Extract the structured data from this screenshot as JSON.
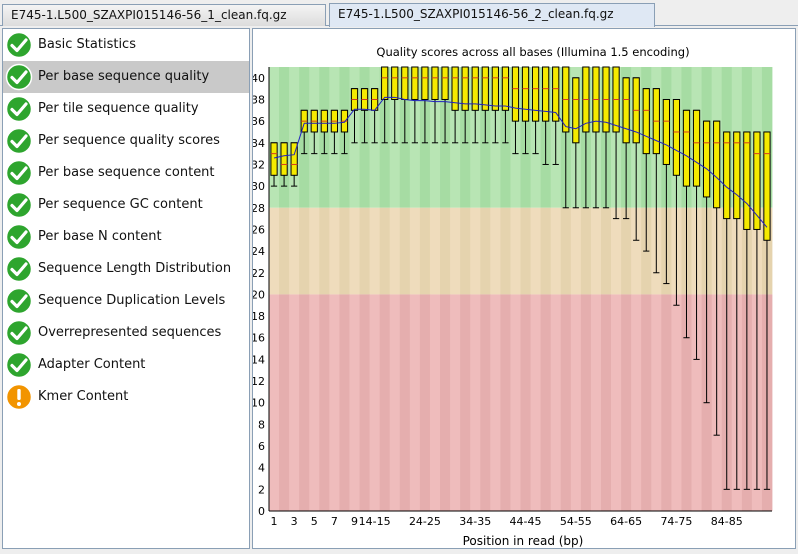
{
  "tabs": [
    {
      "label": "E745-1.L500_SZAXPI015146-56_1_clean.fq.gz",
      "active": false
    },
    {
      "label": "E745-1.L500_SZAXPI015146-56_2_clean.fq.gz",
      "active": true
    }
  ],
  "modules": [
    {
      "label": "Basic Statistics",
      "status": "pass",
      "icon": "pass-check-icon"
    },
    {
      "label": "Per base sequence quality",
      "status": "pass",
      "icon": "pass-check-icon",
      "selected": true
    },
    {
      "label": "Per tile sequence quality",
      "status": "pass",
      "icon": "pass-check-icon"
    },
    {
      "label": "Per sequence quality scores",
      "status": "pass",
      "icon": "pass-check-icon"
    },
    {
      "label": "Per base sequence content",
      "status": "pass",
      "icon": "pass-check-icon"
    },
    {
      "label": "Per sequence GC content",
      "status": "pass",
      "icon": "pass-check-icon"
    },
    {
      "label": "Per base N content",
      "status": "pass",
      "icon": "pass-check-icon"
    },
    {
      "label": "Sequence Length Distribution",
      "status": "pass",
      "icon": "pass-check-icon"
    },
    {
      "label": "Sequence Duplication Levels",
      "status": "pass",
      "icon": "pass-check-icon"
    },
    {
      "label": "Overrepresented sequences",
      "status": "pass",
      "icon": "pass-check-icon"
    },
    {
      "label": "Adapter Content",
      "status": "pass",
      "icon": "pass-check-icon"
    },
    {
      "label": "Kmer Content",
      "status": "warn",
      "icon": "warn-exclamation-icon"
    }
  ],
  "colors": {
    "pass": "#2ea52e",
    "warn": "#f29400",
    "zone_good_a": "#b8e5b4",
    "zone_good_b": "#a6dca3",
    "zone_ok_a": "#efdcbc",
    "zone_ok_b": "#e5d3ae",
    "zone_bad_a": "#efbcbc",
    "zone_bad_b": "#e5aeae",
    "box": "#f5ea00",
    "median": "#d44020",
    "mean_line": "#2020c0"
  },
  "chart_data": {
    "type": "box",
    "title": "Quality scores across all bases (Illumina 1.5 encoding)",
    "xlabel": "Position in read (bp)",
    "ylabel": "",
    "ylim": [
      0,
      41
    ],
    "yticks": [
      0,
      2,
      4,
      6,
      8,
      10,
      12,
      14,
      16,
      18,
      20,
      22,
      24,
      26,
      28,
      30,
      32,
      34,
      36,
      38,
      40
    ],
    "xtick_labels": [
      "1",
      "3",
      "5",
      "7",
      "9",
      "14-15",
      "24-25",
      "34-35",
      "44-45",
      "54-55",
      "64-65",
      "74-75",
      "84-85"
    ],
    "xtick_positions": [
      0,
      2,
      4,
      6,
      8,
      10,
      15,
      20,
      25,
      30,
      35,
      40,
      45
    ],
    "zones": [
      {
        "name": "good",
        "from": 28,
        "to": 41
      },
      {
        "name": "reasonable",
        "from": 20,
        "to": 28
      },
      {
        "name": "poor",
        "from": 0,
        "to": 20
      }
    ],
    "boxes": [
      {
        "pos": 0,
        "low": 30,
        "q1": 31,
        "median": 33,
        "q3": 34,
        "high": 34,
        "mean": 32.6
      },
      {
        "pos": 1,
        "low": 30,
        "q1": 31,
        "median": 32,
        "q3": 34,
        "high": 34,
        "mean": 32.8
      },
      {
        "pos": 2,
        "low": 30,
        "q1": 31,
        "median": 32,
        "q3": 34,
        "high": 34,
        "mean": 32.9
      },
      {
        "pos": 3,
        "low": 33,
        "q1": 35,
        "median": 36,
        "q3": 37,
        "high": 37,
        "mean": 35.8
      },
      {
        "pos": 4,
        "low": 33,
        "q1": 35,
        "median": 36,
        "q3": 37,
        "high": 37,
        "mean": 35.8
      },
      {
        "pos": 5,
        "low": 33,
        "q1": 35,
        "median": 36,
        "q3": 37,
        "high": 37,
        "mean": 35.8
      },
      {
        "pos": 6,
        "low": 33,
        "q1": 35,
        "median": 36,
        "q3": 37,
        "high": 37,
        "mean": 35.8
      },
      {
        "pos": 7,
        "low": 33,
        "q1": 35,
        "median": 36,
        "q3": 37,
        "high": 37,
        "mean": 35.9
      },
      {
        "pos": 8,
        "low": 34,
        "q1": 37,
        "median": 38,
        "q3": 39,
        "high": 39,
        "mean": 37.1
      },
      {
        "pos": 9,
        "low": 34,
        "q1": 37,
        "median": 38,
        "q3": 39,
        "high": 39,
        "mean": 37.1
      },
      {
        "pos": 10,
        "low": 34,
        "q1": 37,
        "median": 38,
        "q3": 39,
        "high": 39,
        "mean": 37.0
      },
      {
        "pos": 11,
        "low": 34,
        "q1": 38,
        "median": 40,
        "q3": 41,
        "high": 41,
        "mean": 38.2
      },
      {
        "pos": 12,
        "low": 34,
        "q1": 38,
        "median": 40,
        "q3": 41,
        "high": 41,
        "mean": 38.2
      },
      {
        "pos": 13,
        "low": 34,
        "q1": 38,
        "median": 40,
        "q3": 41,
        "high": 41,
        "mean": 38.0
      },
      {
        "pos": 14,
        "low": 34,
        "q1": 38,
        "median": 40,
        "q3": 41,
        "high": 41,
        "mean": 37.9
      },
      {
        "pos": 15,
        "low": 34,
        "q1": 38,
        "median": 40,
        "q3": 41,
        "high": 41,
        "mean": 37.9
      },
      {
        "pos": 16,
        "low": 34,
        "q1": 38,
        "median": 40,
        "q3": 41,
        "high": 41,
        "mean": 37.8
      },
      {
        "pos": 17,
        "low": 34,
        "q1": 38,
        "median": 40,
        "q3": 41,
        "high": 41,
        "mean": 37.8
      },
      {
        "pos": 18,
        "low": 34,
        "q1": 37,
        "median": 40,
        "q3": 41,
        "high": 41,
        "mean": 37.7
      },
      {
        "pos": 19,
        "low": 34,
        "q1": 37,
        "median": 40,
        "q3": 41,
        "high": 41,
        "mean": 37.6
      },
      {
        "pos": 20,
        "low": 34,
        "q1": 37,
        "median": 40,
        "q3": 41,
        "high": 41,
        "mean": 37.6
      },
      {
        "pos": 21,
        "low": 34,
        "q1": 37,
        "median": 40,
        "q3": 41,
        "high": 41,
        "mean": 37.5
      },
      {
        "pos": 22,
        "low": 34,
        "q1": 37,
        "median": 40,
        "q3": 41,
        "high": 41,
        "mean": 37.4
      },
      {
        "pos": 23,
        "low": 34,
        "q1": 37,
        "median": 40,
        "q3": 41,
        "high": 41,
        "mean": 37.4
      },
      {
        "pos": 24,
        "low": 33,
        "q1": 36,
        "median": 39,
        "q3": 41,
        "high": 41,
        "mean": 37.2
      },
      {
        "pos": 25,
        "low": 33,
        "q1": 36,
        "median": 39,
        "q3": 41,
        "high": 41,
        "mean": 37.1
      },
      {
        "pos": 26,
        "low": 33,
        "q1": 36,
        "median": 39,
        "q3": 41,
        "high": 41,
        "mean": 37.0
      },
      {
        "pos": 27,
        "low": 32,
        "q1": 36,
        "median": 39,
        "q3": 41,
        "high": 41,
        "mean": 36.9
      },
      {
        "pos": 28,
        "low": 32,
        "q1": 36,
        "median": 39,
        "q3": 41,
        "high": 41,
        "mean": 36.8
      },
      {
        "pos": 29,
        "low": 28,
        "q1": 35,
        "median": 38,
        "q3": 41,
        "high": 41,
        "mean": 35.5
      },
      {
        "pos": 30,
        "low": 28,
        "q1": 34,
        "median": 38,
        "q3": 40,
        "high": 40,
        "mean": 35.3
      },
      {
        "pos": 31,
        "low": 28,
        "q1": 35,
        "median": 38,
        "q3": 41,
        "high": 41,
        "mean": 35.8
      },
      {
        "pos": 32,
        "low": 28,
        "q1": 35,
        "median": 38,
        "q3": 41,
        "high": 41,
        "mean": 36.0
      },
      {
        "pos": 33,
        "low": 28,
        "q1": 35,
        "median": 38,
        "q3": 41,
        "high": 41,
        "mean": 35.9
      },
      {
        "pos": 34,
        "low": 27,
        "q1": 35,
        "median": 38,
        "q3": 41,
        "high": 41,
        "mean": 35.6
      },
      {
        "pos": 35,
        "low": 27,
        "q1": 34,
        "median": 38,
        "q3": 40,
        "high": 40,
        "mean": 35.3
      },
      {
        "pos": 36,
        "low": 25,
        "q1": 34,
        "median": 37,
        "q3": 40,
        "high": 40,
        "mean": 35.0
      },
      {
        "pos": 37,
        "low": 24,
        "q1": 33,
        "median": 37,
        "q3": 39,
        "high": 39,
        "mean": 34.6
      },
      {
        "pos": 38,
        "low": 22,
        "q1": 33,
        "median": 36,
        "q3": 39,
        "high": 39,
        "mean": 34.2
      },
      {
        "pos": 39,
        "low": 21,
        "q1": 32,
        "median": 36,
        "q3": 38,
        "high": 38,
        "mean": 33.8
      },
      {
        "pos": 40,
        "low": 19,
        "q1": 31,
        "median": 35,
        "q3": 38,
        "high": 38,
        "mean": 33.3
      },
      {
        "pos": 41,
        "low": 16,
        "q1": 30,
        "median": 35,
        "q3": 37,
        "high": 37,
        "mean": 32.8
      },
      {
        "pos": 42,
        "low": 14,
        "q1": 30,
        "median": 34,
        "q3": 37,
        "high": 37,
        "mean": 32.2
      },
      {
        "pos": 43,
        "low": 10,
        "q1": 29,
        "median": 34,
        "q3": 36,
        "high": 36,
        "mean": 31.6
      },
      {
        "pos": 44,
        "low": 7,
        "q1": 28,
        "median": 34,
        "q3": 36,
        "high": 36,
        "mean": 30.8
      },
      {
        "pos": 45,
        "low": 2,
        "q1": 27,
        "median": 34,
        "q3": 35,
        "high": 35,
        "mean": 29.9
      },
      {
        "pos": 46,
        "low": 2,
        "q1": 27,
        "median": 34,
        "q3": 35,
        "high": 35,
        "mean": 29.2
      },
      {
        "pos": 47,
        "low": 2,
        "q1": 26,
        "median": 34,
        "q3": 35,
        "high": 35,
        "mean": 28.4
      },
      {
        "pos": 48,
        "low": 2,
        "q1": 26,
        "median": 33,
        "q3": 35,
        "high": 35,
        "mean": 27.3
      },
      {
        "pos": 49,
        "low": 2,
        "q1": 25,
        "median": 33,
        "q3": 35,
        "high": 35,
        "mean": 26.2
      }
    ]
  }
}
